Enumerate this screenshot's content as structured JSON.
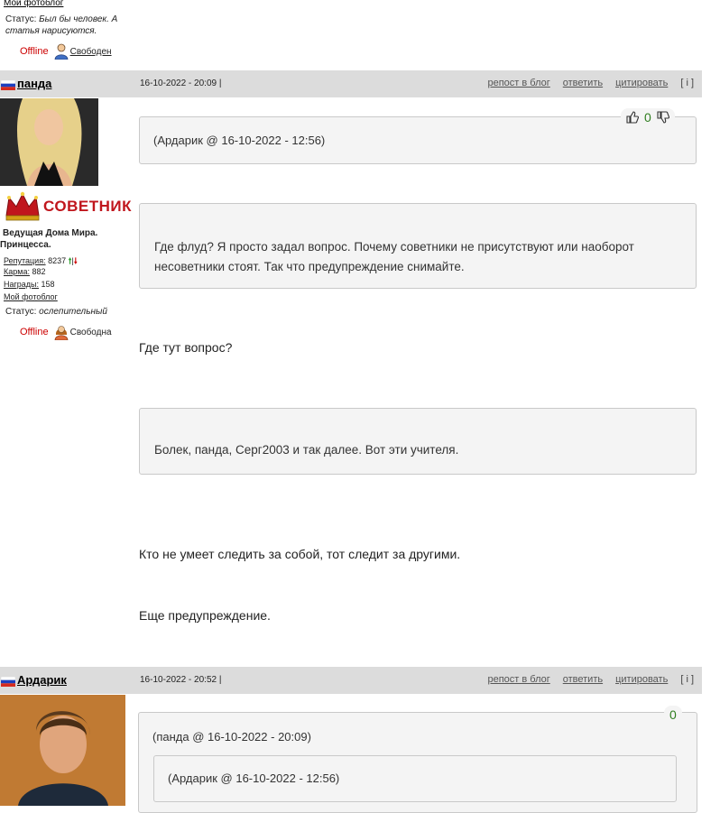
{
  "prev_user": {
    "photoblog": "Мой фотоблог",
    "status_label": "Статус:",
    "status_text": "Был бы человек. А статья нарисуются.",
    "online": "Offline",
    "availability": "Свободен"
  },
  "posts": [
    {
      "author": "панда",
      "date": "16-10-2022 - 20:09 |",
      "actions": {
        "repost": "репост в блог",
        "reply": "ответить",
        "quote": "цитировать",
        "info": "[ i ]"
      },
      "votes": "0",
      "rank": "СОВЕТНИК",
      "user_title_1": "Ведущая Дома Мира.",
      "user_title_2": "Принцесса.",
      "reputation_label": "Репутация:",
      "reputation_value": "8237",
      "karma_label": "Карма:",
      "karma_value": "882",
      "awards_label": "Награды:",
      "awards_value": "158",
      "photoblog": "Мой фотоблог",
      "status_label": "Статус:",
      "status_text": "ослепительный",
      "online": "Offline",
      "availability": "Свободна",
      "quote_header": "(Ардарик @ 16-10-2022 - 12:56)",
      "quote_body": "Где флуд? Я просто задал вопрос. Почему советники не присутствуют или наоборот несоветники стоят. Так что предупреждение снимайте.",
      "text_1": "Где тут вопрос?",
      "quote2_body": "Болек, панда, Серг2003 и так далее. Вот эти учителя.",
      "text_2": "Кто не умеет следить за собой, тот следит за другими.",
      "text_3": "Еще предупреждение."
    },
    {
      "author": "Ардарик",
      "date": "16-10-2022 - 20:52 |",
      "actions": {
        "repost": "репост в блог",
        "reply": "ответить",
        "quote": "цитировать",
        "info": "[ i ]"
      },
      "votes": "0",
      "quote_header": "(панда @ 16-10-2022 - 20:09)",
      "nested_quote_header": "(Ардарик @ 16-10-2022 - 12:56)"
    }
  ],
  "colors": {
    "header_bg": "#dcdcdc",
    "offline": "#cc0000",
    "rank": "#c0161d",
    "vote_count": "#2e7d1e"
  }
}
